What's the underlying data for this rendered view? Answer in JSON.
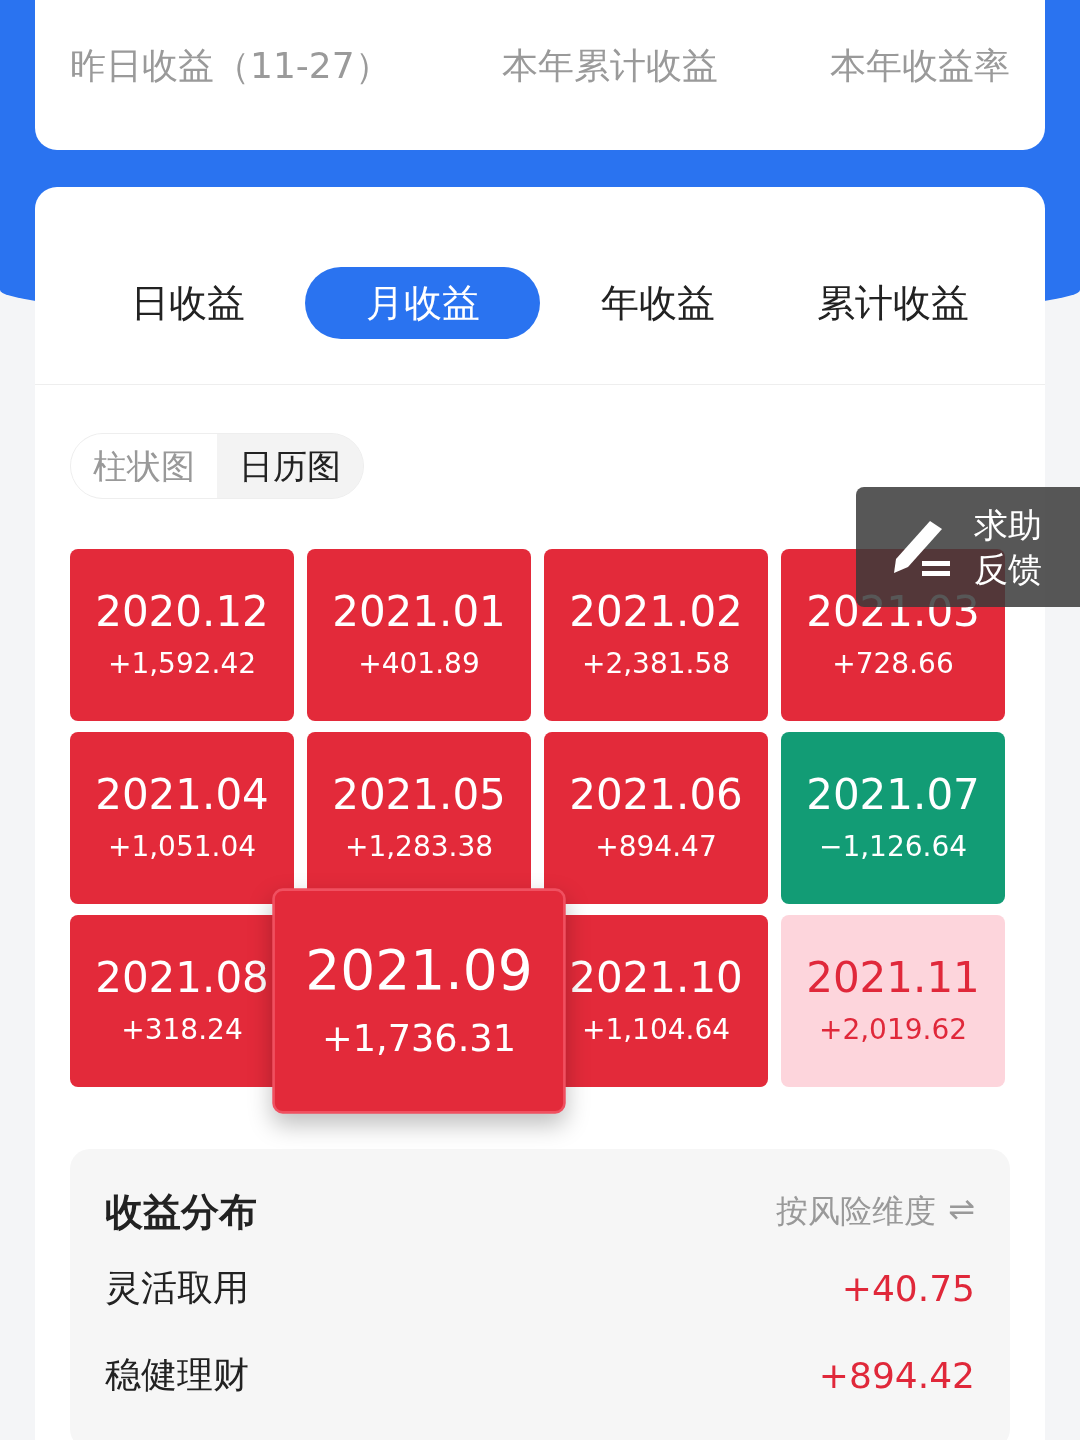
{
  "summary": {
    "items": [
      {
        "label": "昨日收益（11-27）"
      },
      {
        "label": "本年累计收益"
      },
      {
        "label": "本年收益率"
      }
    ]
  },
  "tabs": [
    {
      "label": "日收益",
      "selected": false
    },
    {
      "label": "月收益",
      "selected": true
    },
    {
      "label": "年收益",
      "selected": false
    },
    {
      "label": "累计收益",
      "selected": false
    }
  ],
  "view_toggle": [
    {
      "label": "柱状图",
      "selected": false
    },
    {
      "label": "日历图",
      "selected": true
    }
  ],
  "months": [
    {
      "month": "2020.12",
      "amount": "+1,592.42",
      "kind": "gain",
      "selected": false
    },
    {
      "month": "2021.01",
      "amount": "+401.89",
      "kind": "gain",
      "selected": false
    },
    {
      "month": "2021.02",
      "amount": "+2,381.58",
      "kind": "gain",
      "selected": false
    },
    {
      "month": "2021.03",
      "amount": "+728.66",
      "kind": "gain",
      "selected": false
    },
    {
      "month": "2021.04",
      "amount": "+1,051.04",
      "kind": "gain",
      "selected": false
    },
    {
      "month": "2021.05",
      "amount": "+1,283.38",
      "kind": "gain",
      "selected": false
    },
    {
      "month": "2021.06",
      "amount": "+894.47",
      "kind": "gain",
      "selected": false
    },
    {
      "month": "2021.07",
      "amount": "−1,126.64",
      "kind": "loss",
      "selected": false
    },
    {
      "month": "2021.08",
      "amount": "+318.24",
      "kind": "gain",
      "selected": false
    },
    {
      "month": "2021.09",
      "amount": "+1,736.31",
      "kind": "gain",
      "selected": true
    },
    {
      "month": "2021.10",
      "amount": "+1,104.64",
      "kind": "gain",
      "selected": false
    },
    {
      "month": "2021.11",
      "amount": "+2,019.62",
      "kind": "current",
      "selected": false
    }
  ],
  "feedback": {
    "label": [
      "求助",
      "反馈"
    ]
  },
  "distribution": {
    "title": "收益分布",
    "switch_label": "按风险维度",
    "switch_icon": "⇌",
    "rows": [
      {
        "name": "灵活取用",
        "amount": "+40.75"
      },
      {
        "name": "稳健理财",
        "amount": "+894.42"
      }
    ]
  }
}
